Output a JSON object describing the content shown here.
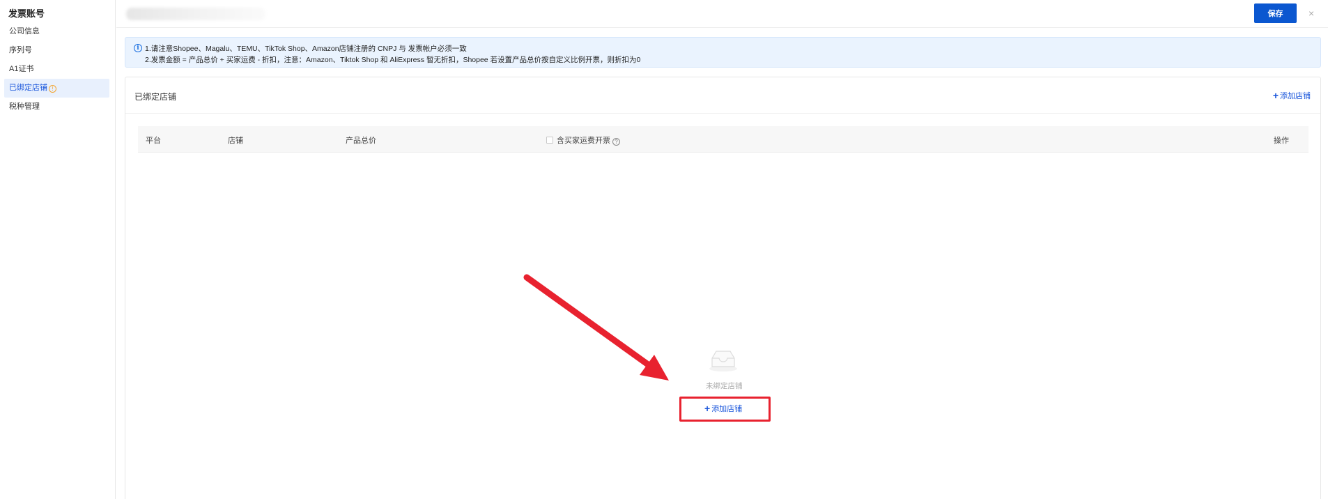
{
  "sidebar": {
    "title": "发票账号",
    "items": [
      {
        "label": "公司信息"
      },
      {
        "label": "序列号"
      },
      {
        "label": "A1证书"
      },
      {
        "label": "已绑定店铺",
        "warn": "!"
      },
      {
        "label": "税种管理"
      }
    ]
  },
  "topbar": {
    "save_label": "保存",
    "close_glyph": "×"
  },
  "notice": {
    "line1": "1.请注意Shopee、Magalu、TEMU、TikTok Shop、Amazon店铺注册的 CNPJ 与 发票帐户必须一致",
    "line2": "2.发票金额 = 产品总价 + 买家运费 - 折扣，注意：Amazon、Tiktok Shop 和 AliExpress 暂无折扣，Shopee 若设置产品总价按自定义比例开票，则折扣为0"
  },
  "card": {
    "title": "已绑定店铺",
    "add_label": "添加店铺"
  },
  "table": {
    "columns": {
      "platform": "平台",
      "store": "店铺",
      "total": "产品总价",
      "shipping": "含买家运费开票",
      "actions": "操作"
    }
  },
  "empty": {
    "text": "未绑定店铺",
    "add_label": "添加店铺"
  },
  "colors": {
    "primary": "#0b57d0",
    "annotation": "#e8222f"
  }
}
